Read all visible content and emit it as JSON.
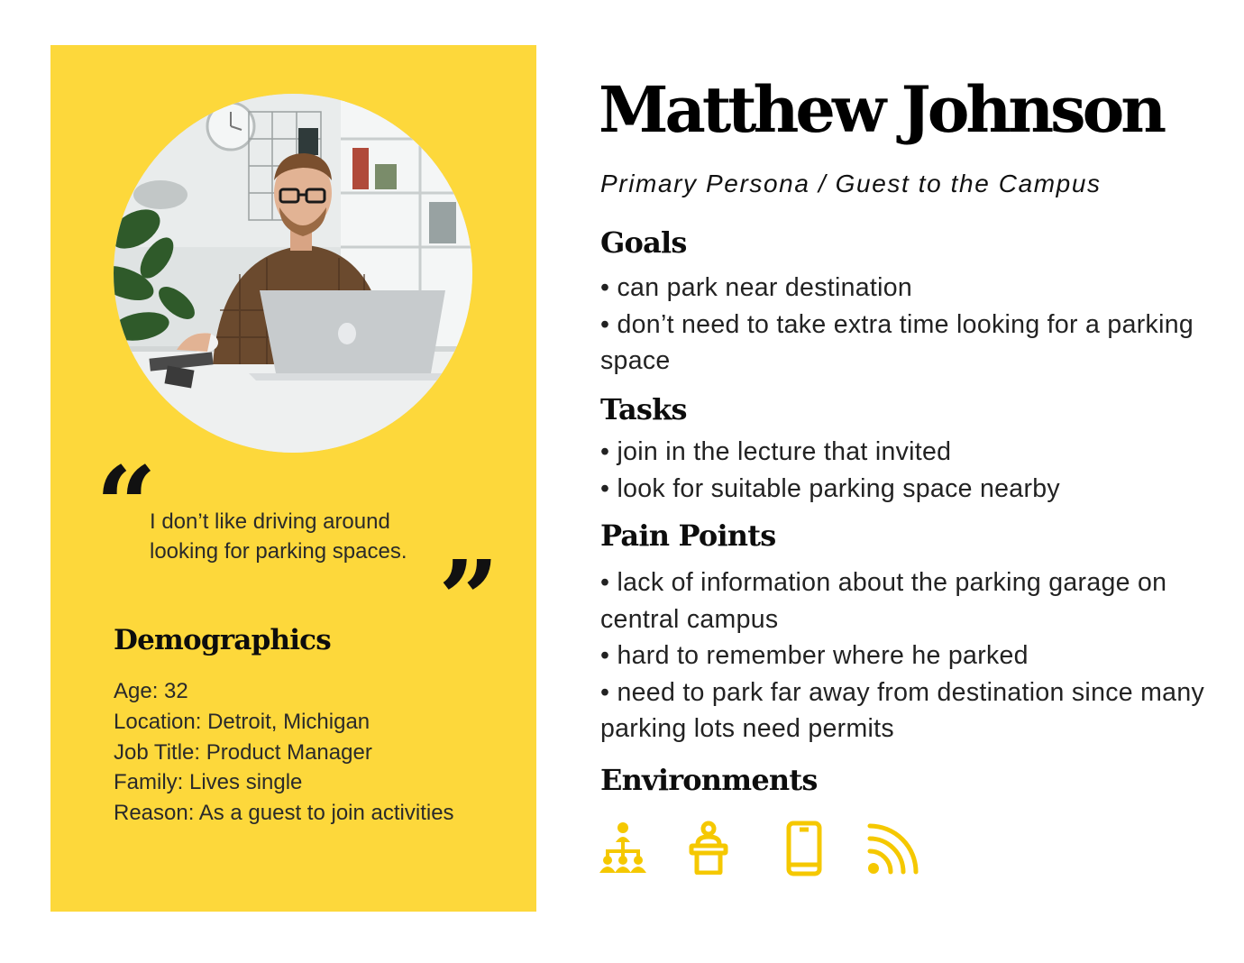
{
  "persona": {
    "name": "Matthew Johnson",
    "role": "Primary Persona / Guest to the Campus"
  },
  "quote": {
    "open_mark": "“",
    "close_mark": "”",
    "lines": [
      "I don’t like driving around",
      "looking for parking spaces."
    ]
  },
  "demographics": {
    "heading": "Demographics",
    "items": [
      "Age: 32",
      "Location: Detroit, Michigan",
      "Job Title: Product Manager",
      "Family: Lives single",
      "Reason: As a guest to join activities"
    ]
  },
  "goals": {
    "heading": "Goals",
    "items": [
      "can park near destination",
      "don’t need to take extra time looking for a parking space"
    ]
  },
  "tasks": {
    "heading": "Tasks",
    "items": [
      "join in the lecture that invited",
      "look for suitable parking space nearby"
    ]
  },
  "pain_points": {
    "heading": "Pain Points",
    "items": [
      "lack of information about the parking garage on central campus",
      "hard to remember where he parked",
      "need to park far away from destination since many parking lots need permits"
    ]
  },
  "environments": {
    "heading": "Environments",
    "icons": [
      "hierarchy-icon",
      "lecture-podium-icon",
      "smartphone-icon",
      "wifi-signal-icon"
    ]
  },
  "colors": {
    "card_background": "#fdd83b",
    "icon_accent": "#f5c800",
    "heading_text": "#0d0d0d"
  }
}
